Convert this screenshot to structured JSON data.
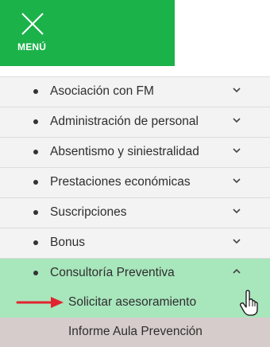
{
  "menu_toggle": {
    "label": "MENÚ",
    "icon": "close-icon",
    "background": "#1bb24a"
  },
  "menu": {
    "items": [
      {
        "label": "Asociación con FM",
        "icon": "chevron-down-icon"
      },
      {
        "label": "Administración de personal",
        "icon": "chevron-down-icon"
      },
      {
        "label": "Absentismo y siniestralidad",
        "icon": "chevron-down-icon"
      },
      {
        "label": "Prestaciones económicas",
        "icon": "chevron-down-icon"
      },
      {
        "label": "Suscripciones",
        "icon": "chevron-down-icon"
      },
      {
        "label": "Bonus",
        "icon": "chevron-down-icon"
      },
      {
        "label": "Consultoría Preventiva",
        "icon": "chevron-up-icon",
        "expanded": true
      }
    ],
    "submenu": [
      {
        "label": "Solicitar asesoramiento"
      },
      {
        "label": "Informe Aula Prevención"
      }
    ]
  },
  "colors": {
    "active_bg": "#a8e6bc",
    "item_bg": "#f3f3f3",
    "submenu_alt_bg": "#d6cccc",
    "arrow": "#e0242f"
  }
}
